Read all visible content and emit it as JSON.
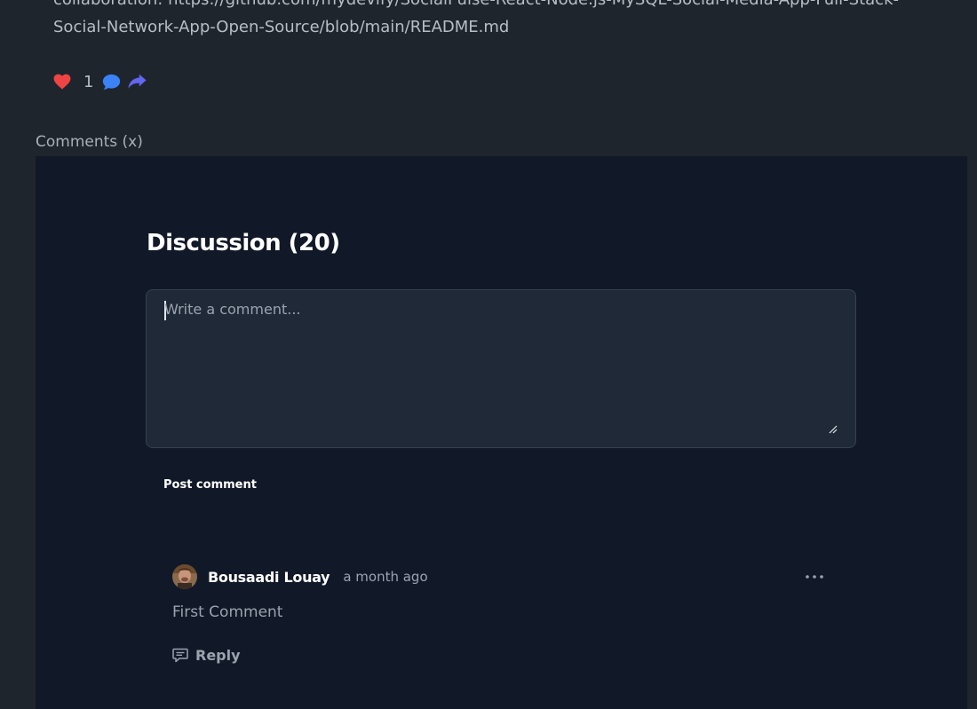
{
  "post": {
    "text": "collaboration: https://github.com/mydevify/SocialPulse-React-Node.js-MySQL-Social-Media-App-Full-Stack-Social-Network-App-Open-Source/blob/main/README.md",
    "like_count": "1",
    "icons": {
      "like": "heart-icon",
      "comment": "comment-bubble-icon",
      "share": "share-arrow-icon"
    },
    "colors": {
      "like": "#ef4444",
      "comment": "#3b82f6",
      "share": "#6366f1"
    }
  },
  "comments_section": {
    "label": "Comments (x)"
  },
  "discussion": {
    "title": "Discussion (20)",
    "textarea_placeholder": "Write a comment...",
    "post_button_label": "Post comment",
    "comments": [
      {
        "author": "Bousaadi Louay",
        "time": "a month ago",
        "body": "First Comment",
        "reply_label": "Reply"
      }
    ]
  }
}
